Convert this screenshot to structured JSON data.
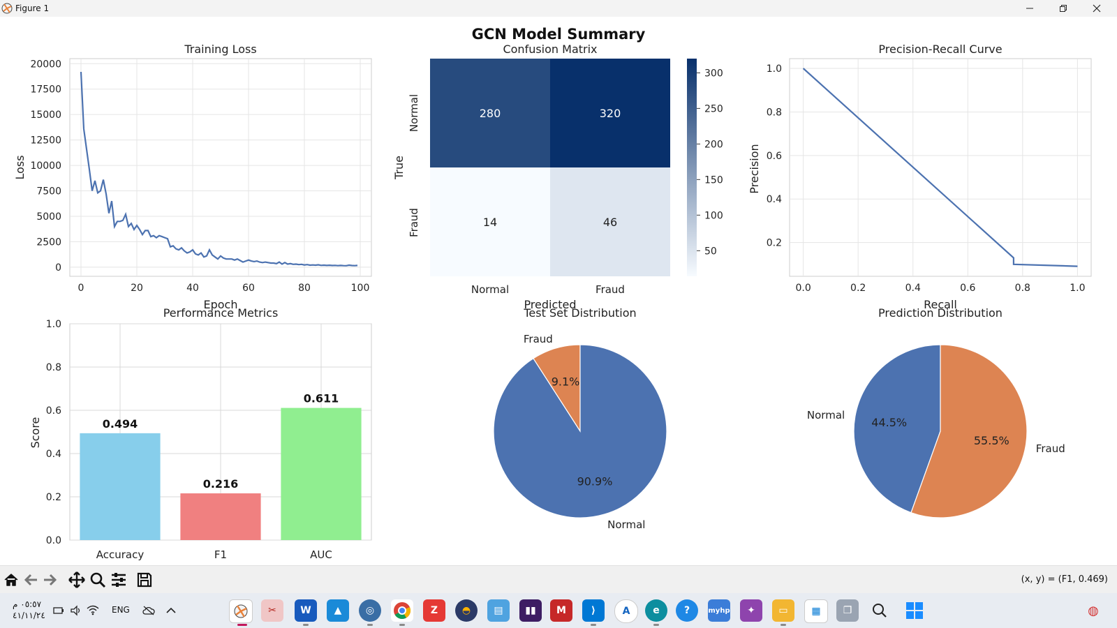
{
  "window": {
    "title": "Figure 1"
  },
  "figure": {
    "suptitle": "GCN Model Summary",
    "training_loss": {
      "title": "Training Loss",
      "xlabel": "Epoch",
      "ylabel": "Loss",
      "xticks": [
        "0",
        "20",
        "40",
        "60",
        "80",
        "100"
      ],
      "yticks": [
        "0",
        "2500",
        "5000",
        "7500",
        "10000",
        "12500",
        "15000",
        "17500",
        "20000"
      ]
    },
    "confusion": {
      "title": "Confusion Matrix",
      "xlabel": "Predicted",
      "ylabel": "True",
      "row_labels": [
        "Normal",
        "Fraud"
      ],
      "col_labels": [
        "Normal",
        "Fraud"
      ],
      "cbar_ticks": [
        "300",
        "250",
        "200",
        "150",
        "100",
        "50"
      ]
    },
    "pr_curve": {
      "title": "Precision-Recall Curve",
      "xlabel": "Recall",
      "ylabel": "Precision",
      "xticks": [
        "0.0",
        "0.2",
        "0.4",
        "0.6",
        "0.8",
        "1.0"
      ],
      "yticks": [
        "0.2",
        "0.4",
        "0.6",
        "0.8",
        "1.0"
      ]
    },
    "metrics": {
      "title": "Performance Metrics",
      "ylabel": "Score",
      "yticks": [
        "0.0",
        "0.2",
        "0.4",
        "0.6",
        "0.8",
        "1.0"
      ]
    },
    "test_dist": {
      "title": "Test Set Distribution"
    },
    "pred_dist": {
      "title": "Prediction Distribution"
    }
  },
  "chart_data": [
    {
      "type": "line",
      "title": "Training Loss",
      "xlabel": "Epoch",
      "ylabel": "Loss",
      "xlim": [
        -4,
        104
      ],
      "ylim": [
        -900,
        20500
      ],
      "grid": true,
      "color": "#4c72b0",
      "x": [
        0,
        1,
        2,
        3,
        4,
        5,
        6,
        7,
        8,
        9,
        10,
        11,
        12,
        13,
        14,
        15,
        16,
        17,
        18,
        19,
        20,
        21,
        22,
        23,
        24,
        25,
        26,
        27,
        28,
        29,
        30,
        31,
        32,
        33,
        34,
        35,
        36,
        37,
        38,
        39,
        40,
        41,
        42,
        43,
        44,
        45,
        46,
        47,
        48,
        49,
        50,
        51,
        52,
        53,
        54,
        55,
        56,
        57,
        58,
        59,
        60,
        61,
        62,
        63,
        64,
        65,
        66,
        67,
        68,
        69,
        70,
        71,
        72,
        73,
        74,
        75,
        76,
        77,
        78,
        79,
        80,
        81,
        82,
        83,
        84,
        85,
        86,
        87,
        88,
        89,
        90,
        91,
        92,
        93,
        94,
        95,
        96,
        97,
        98,
        99
      ],
      "y": [
        19200,
        13600,
        11600,
        9600,
        7500,
        8500,
        7300,
        7500,
        8600,
        7200,
        5300,
        6500,
        4000,
        4500,
        4500,
        4600,
        5200,
        4000,
        4300,
        3700,
        4100,
        3700,
        3200,
        3600,
        3600,
        3000,
        3100,
        2900,
        3100,
        3000,
        2900,
        2800,
        2000,
        2100,
        1800,
        1700,
        1900,
        1600,
        1400,
        1500,
        1700,
        1300,
        1200,
        1400,
        1000,
        1100,
        1700,
        1200,
        1000,
        800,
        1100,
        900,
        800,
        800,
        800,
        700,
        800,
        650,
        500,
        600,
        700,
        600,
        550,
        600,
        500,
        450,
        500,
        450,
        400,
        400,
        350,
        500,
        300,
        450,
        300,
        350,
        280,
        300,
        250,
        280,
        220,
        250,
        200,
        220,
        200,
        230,
        180,
        200,
        170,
        190,
        160,
        180,
        150,
        170,
        150,
        140,
        200,
        160,
        150,
        170
      ]
    },
    {
      "type": "heatmap",
      "title": "Confusion Matrix",
      "xlabel": "Predicted",
      "ylabel": "True",
      "rows": [
        "Normal",
        "Fraud"
      ],
      "cols": [
        "Normal",
        "Fraud"
      ],
      "values": [
        [
          280,
          320
        ],
        [
          14,
          46
        ]
      ],
      "colormap": "Blues",
      "vmin": 14,
      "vmax": 320,
      "colorbar_ticks": [
        50,
        100,
        150,
        200,
        250,
        300
      ]
    },
    {
      "type": "line",
      "title": "Precision-Recall Curve",
      "xlabel": "Recall",
      "ylabel": "Precision",
      "xlim": [
        -0.05,
        1.05
      ],
      "ylim": [
        0.045,
        1.045
      ],
      "grid": true,
      "color": "#4c72b0",
      "x": [
        0.0,
        0.767,
        0.767,
        1.0
      ],
      "y": [
        1.0,
        0.13,
        0.1,
        0.091
      ]
    },
    {
      "type": "bar",
      "title": "Performance Metrics",
      "ylabel": "Score",
      "ylim": [
        0,
        1.0
      ],
      "categories": [
        "Accuracy",
        "F1",
        "AUC"
      ],
      "values": [
        0.494,
        0.216,
        0.611
      ],
      "labels": [
        "0.494",
        "0.216",
        "0.611"
      ],
      "colors": [
        "#87ceeb",
        "#f08080",
        "#90ee90"
      ]
    },
    {
      "type": "pie",
      "title": "Test Set Distribution",
      "start_angle": 90,
      "labels": [
        "Fraud",
        "Normal"
      ],
      "values": [
        9.1,
        90.9
      ],
      "pct_labels": [
        "9.1%",
        "90.9%"
      ],
      "colors": [
        "#dd8452",
        "#4c72b0"
      ]
    },
    {
      "type": "pie",
      "title": "Prediction Distribution",
      "start_angle": 90,
      "labels": [
        "Normal",
        "Fraud"
      ],
      "values": [
        44.5,
        55.5
      ],
      "pct_labels": [
        "44.5%",
        "55.5%"
      ],
      "colors": [
        "#4c72b0",
        "#dd8452"
      ]
    }
  ],
  "toolbar": {
    "buttons": [
      "home-icon",
      "back-icon",
      "forward-icon",
      "pan-icon",
      "zoom-icon",
      "configure-icon",
      "save-icon"
    ],
    "coords": "(x, y) = (F1, 0.469)"
  },
  "taskbar": {
    "time": "٠٥:٥٧ م",
    "date": "٤١/١١/٢٤",
    "lang": "ENG"
  }
}
